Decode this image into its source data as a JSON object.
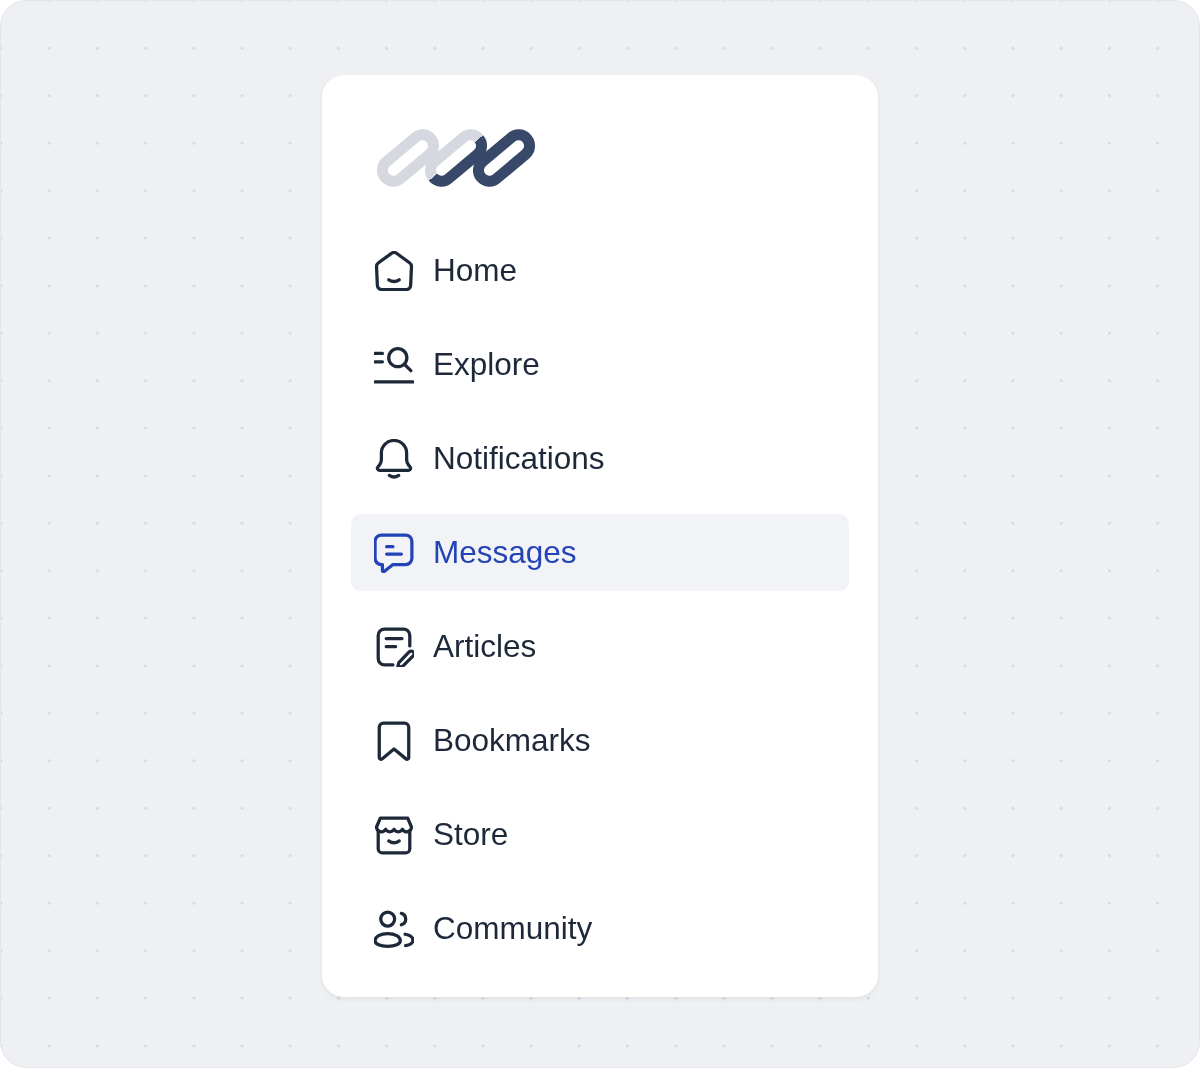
{
  "sidebar": {
    "items": [
      {
        "label": "Home",
        "kind": "home",
        "selected": false
      },
      {
        "label": "Explore",
        "kind": "explore",
        "selected": false
      },
      {
        "label": "Notifications",
        "kind": "bell",
        "selected": false
      },
      {
        "label": "Messages",
        "kind": "chat",
        "selected": true
      },
      {
        "label": "Articles",
        "kind": "article",
        "selected": false
      },
      {
        "label": "Bookmarks",
        "kind": "bookmark",
        "selected": false
      },
      {
        "label": "Store",
        "kind": "store",
        "selected": false
      },
      {
        "label": "Community",
        "kind": "people",
        "selected": false
      }
    ]
  }
}
